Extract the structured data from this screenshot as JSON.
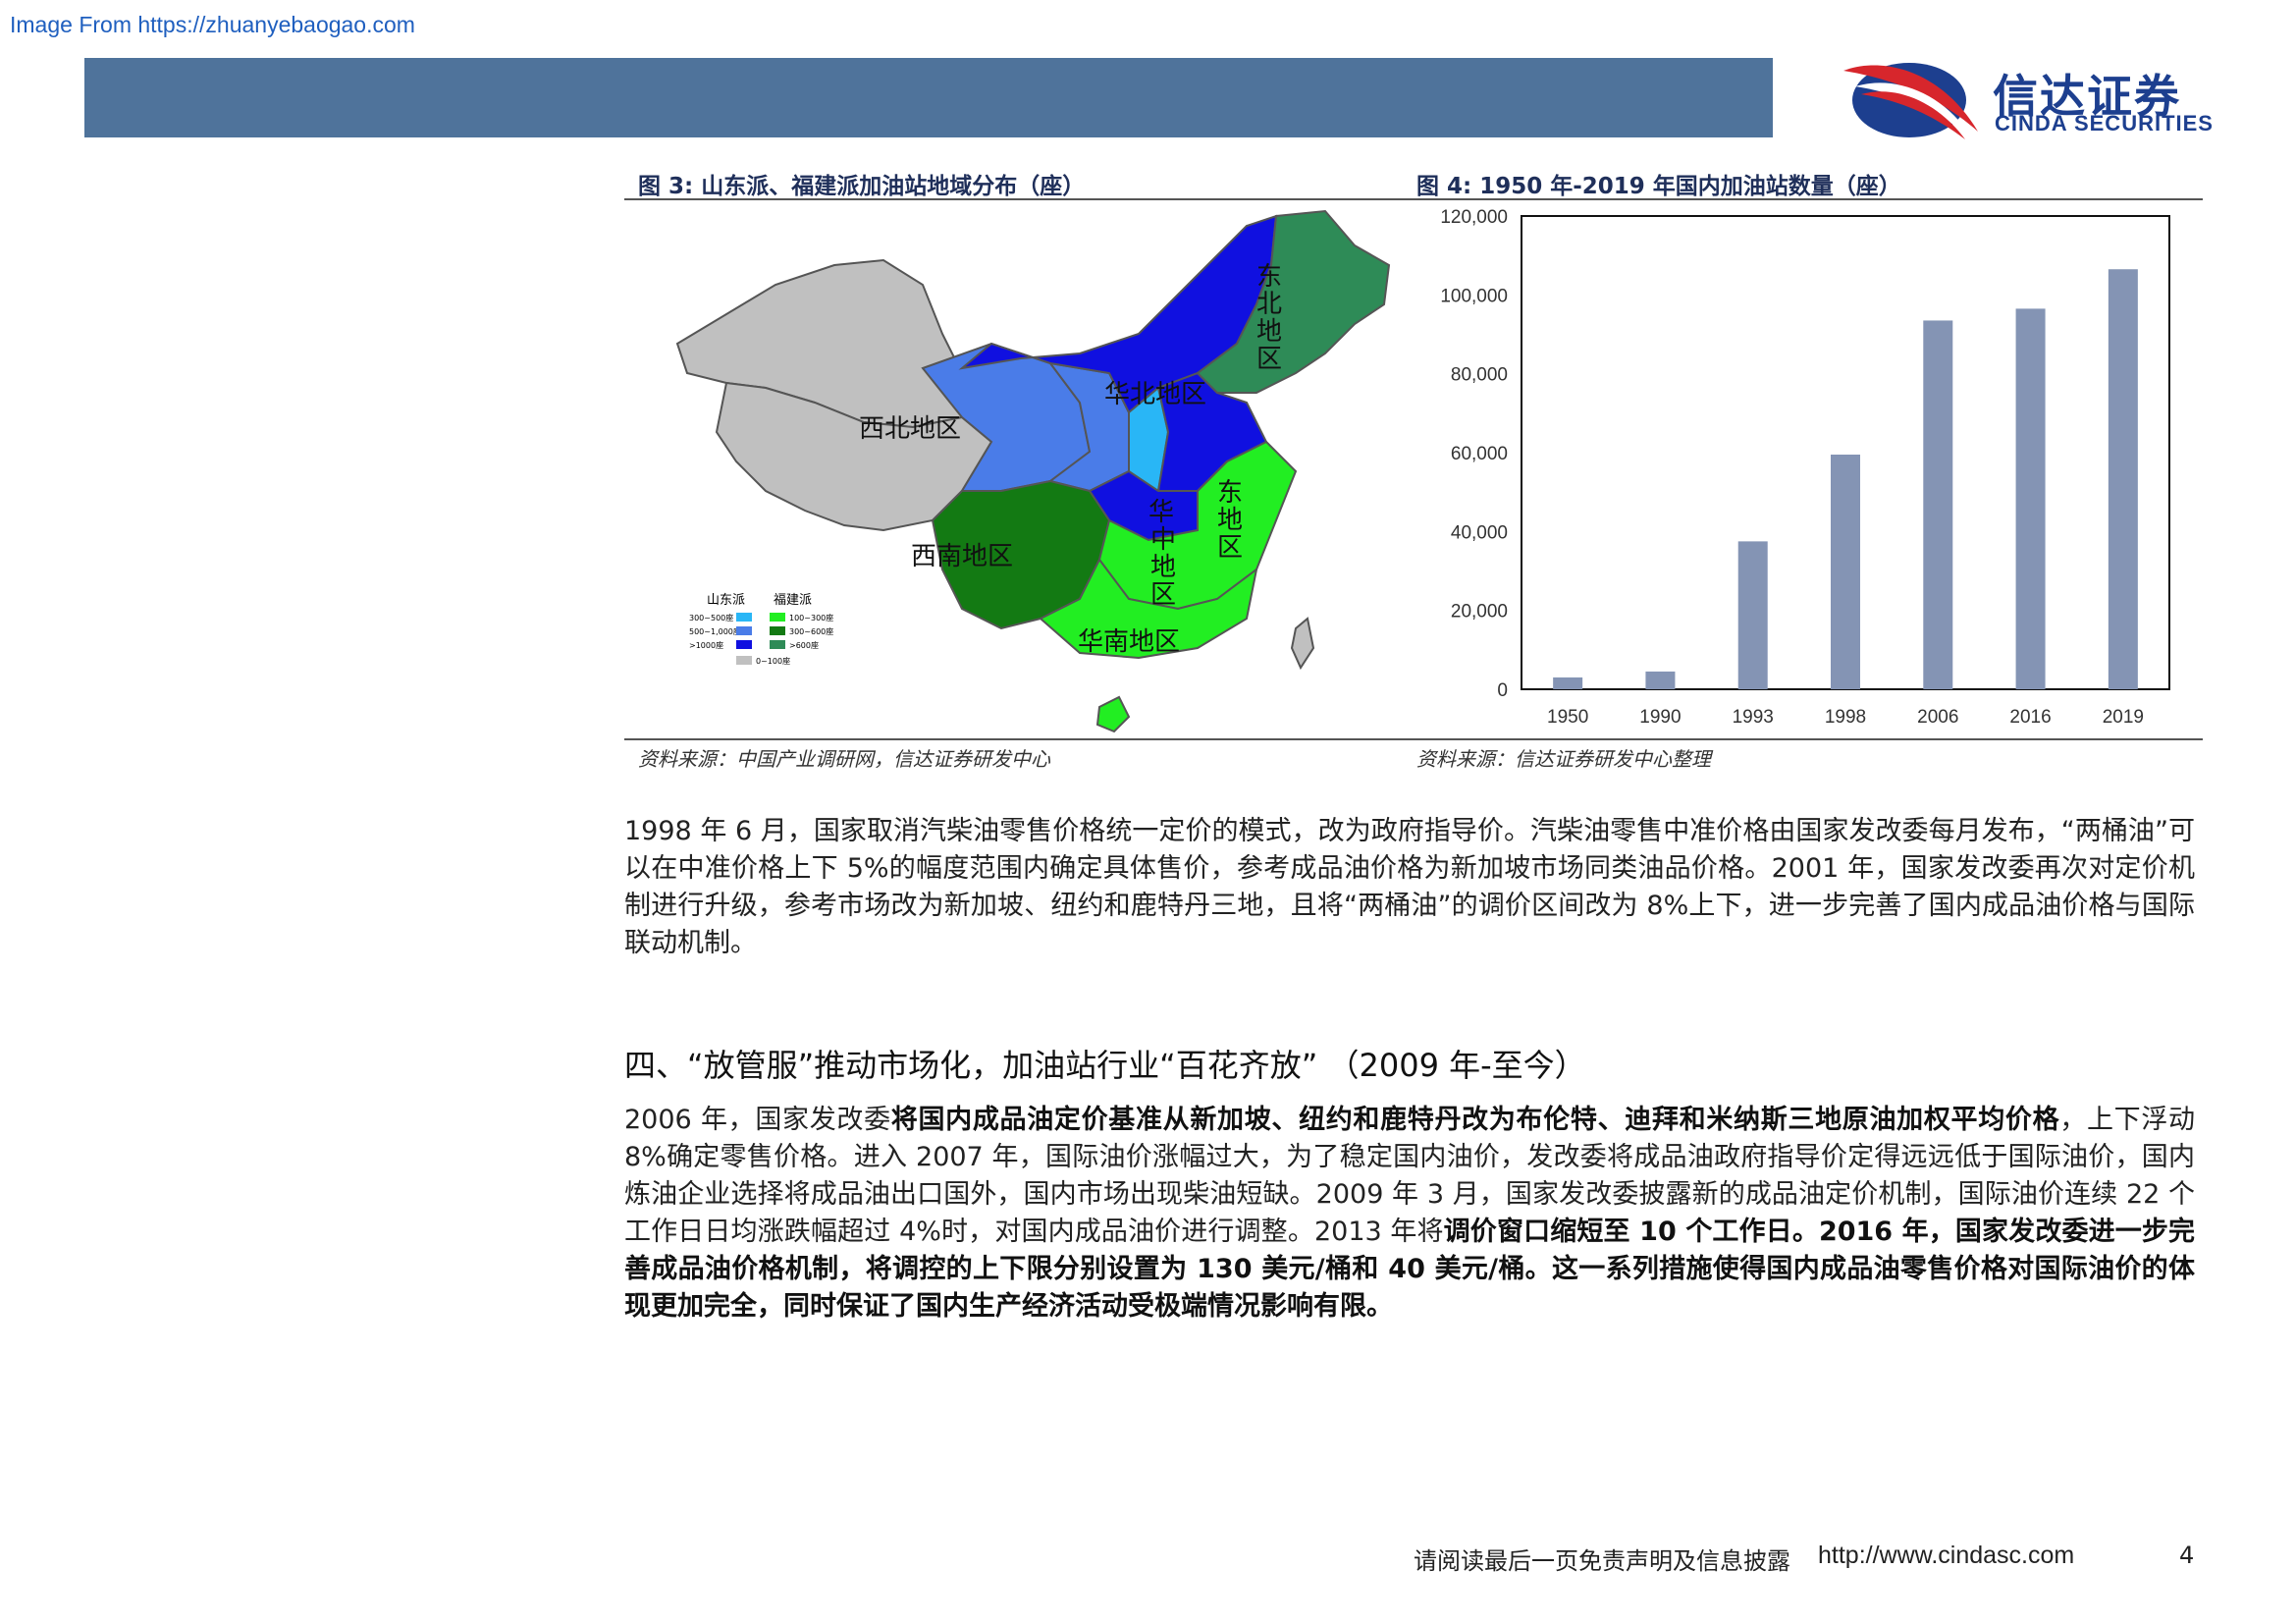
{
  "watermark": "Image From https://zhuanyebaogao.com",
  "logo": {
    "cn": "信达证券",
    "en": "CINDA SECURITIES"
  },
  "figure3": {
    "title": "图 3:  山东派、福建派加油站地域分布（座）",
    "source": "资料来源：中国产业调研网，信达证券研发中心",
    "regions": {
      "northeast": "东北地区",
      "north": "华北地区",
      "northwest": "西北地区",
      "east": "华东地区",
      "central": "华中地区",
      "southwest": "西南地区",
      "south": "华南地区"
    },
    "legend": {
      "shandong_title": "山东派",
      "fujian_title": "福建派",
      "shandong_items": [
        "300~500座",
        "500~1,000座",
        ">1000座"
      ],
      "fujian_items": [
        "100~300座",
        "300~600座",
        ">600座"
      ],
      "other": "0~100座"
    },
    "colors": {
      "shandong_low": "#29b6f6",
      "shandong_mid": "#4a7ce8",
      "shandong_high": "#1010e0",
      "fujian_low": "#22ee22",
      "fujian_mid": "#137a13",
      "fujian_high": "#2e8b57",
      "other": "#c0c0c0"
    }
  },
  "figure4": {
    "title": "图 4: 1950 年-2019 年国内加油站数量（座）",
    "source": "资料来源：信达证券研发中心整理"
  },
  "chart_data": {
    "type": "bar",
    "categories": [
      "1950",
      "1990",
      "1993",
      "1998",
      "2006",
      "2016",
      "2019"
    ],
    "values": [
      3000,
      4500,
      37500,
      59500,
      93500,
      96500,
      106500
    ],
    "ylim": [
      0,
      120000
    ],
    "yticks": [
      "0",
      "20,000",
      "40,000",
      "60,000",
      "80,000",
      "100,000",
      "120,000"
    ],
    "bar_color": "#8494b4",
    "grid": false
  },
  "paragraph1": "1998 年 6 月，国家取消汽柴油零售价格统一定价的模式，改为政府指导价。汽柴油零售中准价格由国家发改委每月发布，“两桶油”可以在中准价格上下 5%的幅度范围内确定具体售价，参考成品油价格为新加坡市场同类油品价格。2001 年，国家发改委再次对定价机制进行升级，参考市场改为新加坡、纽约和鹿特丹三地，且将“两桶油”的调价区间改为 8%上下，进一步完善了国内成品油价格与国际联动机制。",
  "section_heading": "四、“放管服”推动市场化，加油站行业“百花齐放”  （2009 年-至今）",
  "paragraph2": {
    "p1": "2006 年，国家发改委",
    "b1": "将国内成品油定价基准从新加坡、纽约和鹿特丹改为布伦特、迪拜和米纳斯三地原油加权平均价格",
    "p2": "，上下浮动 8%确定零售价格。进入 2007 年，国际油价涨幅过大，为了稳定国内油价，发改委将成品油政府指导价定得远远低于国际油价，国内炼油企业选择将成品油出口国外，国内市场出现柴油短缺。2009 年 3 月，国家发改委披露新的成品油定价机制，国际油价连续 22 个工作日日均涨跌幅超过 4%时，对国内成品油价进行调整。2013 年将",
    "b2": "调价窗口缩短至 10 个工作日。2016 年，国家发改委进一步完善成品油价格机制，将调控的上下限分别设置为 130 美元/桶和 40 美元/桶。这一系列措施使得国内成品油零售价格对国际油价的体现更加完全，同时保证了国内生产经济活动受极端情况影响有限。"
  },
  "footer": {
    "disclaimer": "请阅读最后一页免责声明及信息披露",
    "url": "http://www.cindasc.com",
    "page": "4"
  }
}
